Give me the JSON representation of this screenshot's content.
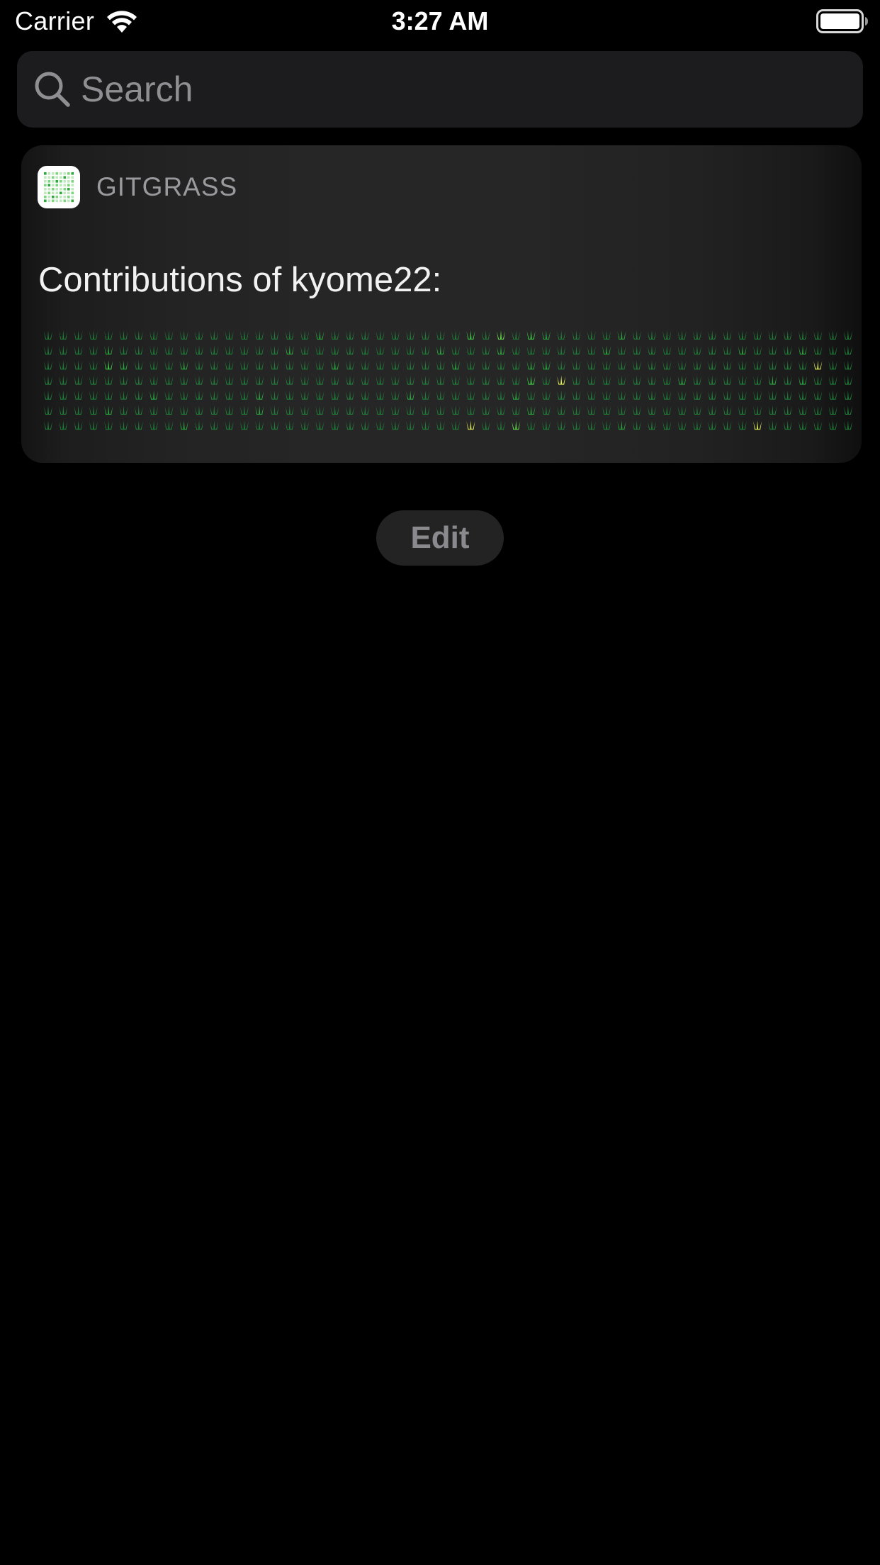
{
  "status_bar": {
    "carrier": "Carrier",
    "time": "3:27 AM",
    "wifi_icon": "wifi-icon",
    "battery_icon": "battery-full-icon"
  },
  "search": {
    "placeholder": "Search",
    "value": "",
    "icon": "search-icon"
  },
  "widget": {
    "app_name": "GITGRASS",
    "app_icon": "gitgrass-app-icon",
    "title": "Contributions of kyome22:",
    "contribution_levels": [
      [
        0,
        0,
        0,
        0,
        0,
        0,
        0,
        0,
        0,
        0,
        0,
        0,
        0,
        0,
        0,
        0,
        0,
        0,
        1,
        0,
        0,
        0,
        0,
        0,
        0,
        0,
        0,
        0,
        2,
        0,
        3,
        0,
        2,
        1,
        0,
        0,
        0,
        0,
        1,
        0,
        0,
        0,
        0,
        0,
        0,
        0,
        0,
        0,
        0,
        0,
        0,
        0,
        0,
        0
      ],
      [
        0,
        0,
        0,
        0,
        1,
        0,
        0,
        0,
        0,
        0,
        0,
        0,
        0,
        0,
        0,
        0,
        1,
        0,
        0,
        0,
        0,
        0,
        0,
        0,
        0,
        0,
        1,
        0,
        0,
        0,
        1,
        0,
        0,
        0,
        0,
        0,
        0,
        1,
        0,
        0,
        0,
        0,
        0,
        0,
        0,
        0,
        1,
        0,
        0,
        0,
        1,
        0,
        0,
        0
      ],
      [
        0,
        0,
        0,
        0,
        2,
        1,
        0,
        0,
        0,
        1,
        0,
        0,
        0,
        0,
        0,
        0,
        0,
        0,
        0,
        1,
        0,
        0,
        0,
        0,
        0,
        0,
        0,
        1,
        0,
        0,
        0,
        0,
        1,
        1,
        0,
        0,
        0,
        0,
        0,
        0,
        0,
        0,
        0,
        0,
        0,
        0,
        0,
        0,
        0,
        0,
        0,
        4,
        0,
        0
      ],
      [
        0,
        0,
        0,
        0,
        0,
        0,
        0,
        0,
        0,
        0,
        0,
        0,
        0,
        0,
        0,
        0,
        0,
        0,
        0,
        0,
        0,
        0,
        0,
        0,
        0,
        0,
        0,
        0,
        0,
        0,
        0,
        0,
        2,
        0,
        4,
        0,
        0,
        0,
        0,
        0,
        0,
        0,
        1,
        0,
        0,
        0,
        0,
        0,
        1,
        0,
        1,
        0,
        0,
        0
      ],
      [
        0,
        0,
        0,
        0,
        0,
        0,
        0,
        1,
        0,
        0,
        0,
        0,
        0,
        0,
        1,
        0,
        0,
        0,
        0,
        0,
        0,
        0,
        0,
        0,
        1,
        0,
        0,
        0,
        0,
        0,
        0,
        1,
        0,
        0,
        0,
        0,
        0,
        0,
        0,
        0,
        0,
        0,
        0,
        0,
        0,
        0,
        0,
        0,
        0,
        0,
        0,
        0,
        0,
        0
      ],
      [
        0,
        0,
        0,
        0,
        1,
        0,
        0,
        0,
        0,
        0,
        0,
        0,
        0,
        0,
        1,
        0,
        0,
        0,
        0,
        0,
        0,
        0,
        0,
        0,
        0,
        0,
        0,
        0,
        0,
        0,
        0,
        0,
        1,
        0,
        0,
        0,
        0,
        0,
        0,
        0,
        0,
        0,
        0,
        0,
        0,
        0,
        0,
        0,
        0,
        0,
        0,
        0,
        0,
        0
      ],
      [
        0,
        0,
        0,
        0,
        0,
        0,
        0,
        0,
        0,
        1,
        0,
        0,
        0,
        0,
        0,
        0,
        0,
        0,
        0,
        0,
        0,
        0,
        0,
        0,
        0,
        0,
        0,
        0,
        4,
        0,
        0,
        3,
        0,
        0,
        0,
        0,
        0,
        0,
        1,
        0,
        0,
        0,
        0,
        0,
        0,
        0,
        0,
        4,
        0,
        0,
        0,
        0,
        0,
        0
      ]
    ],
    "level_colors": [
      "#1f7f38",
      "#29a83e",
      "#3fd147",
      "#64e04c",
      "#e4f25a"
    ]
  },
  "edit_button": {
    "label": "Edit"
  }
}
